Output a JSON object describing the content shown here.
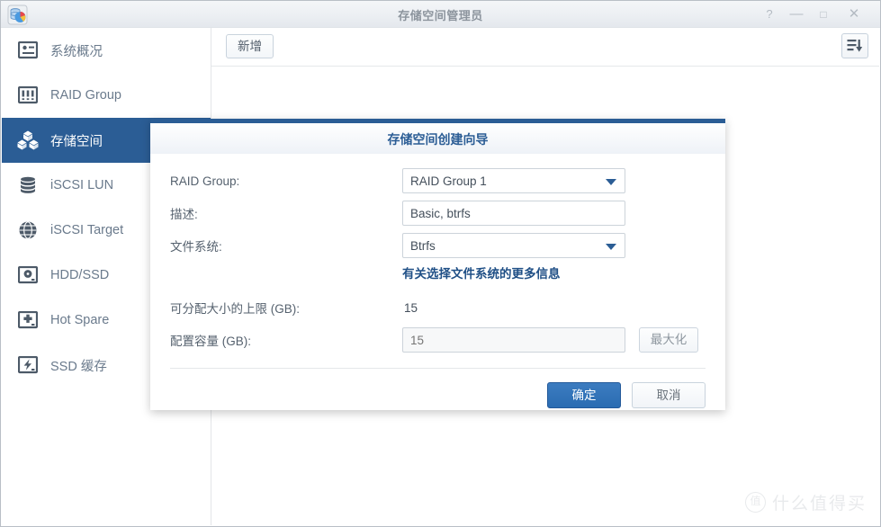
{
  "window": {
    "title": "存储空间管理员",
    "app_icon": "storage-manager-icon",
    "controls": {
      "help": "?",
      "minimize": "—",
      "maximize": "□",
      "close": "✕"
    }
  },
  "sidebar": {
    "items": [
      {
        "label": "系统概况",
        "icon": "system-overview-icon",
        "selected": false
      },
      {
        "label": "RAID Group",
        "icon": "raid-group-icon",
        "selected": false
      },
      {
        "label": "存储空间",
        "icon": "storage-volume-icon",
        "selected": true
      },
      {
        "label": "iSCSI LUN",
        "icon": "database-icon",
        "selected": false
      },
      {
        "label": "iSCSI Target",
        "icon": "globe-icon",
        "selected": false
      },
      {
        "label": "HDD/SSD",
        "icon": "disk-icon",
        "selected": false
      },
      {
        "label": "Hot Spare",
        "icon": "hot-spare-icon",
        "selected": false
      },
      {
        "label": "SSD 缓存",
        "icon": "ssd-cache-icon",
        "selected": false
      }
    ]
  },
  "toolbar": {
    "add_label": "新增",
    "sort_icon": "sort-descending-icon"
  },
  "dialog": {
    "title": "存储空间创建向导",
    "fields": {
      "raid_group": {
        "label": "RAID Group:",
        "value": "RAID Group 1",
        "type": "select"
      },
      "description": {
        "label": "描述:",
        "value": "Basic, btrfs",
        "type": "text"
      },
      "file_system": {
        "label": "文件系统:",
        "value": "Btrfs",
        "type": "select"
      },
      "max_size": {
        "label": "可分配大小的上限 (GB):",
        "value": "15",
        "type": "static"
      },
      "allocate_size": {
        "label": "配置容量 (GB):",
        "placeholder": "15",
        "value": "",
        "type": "text-disabled"
      }
    },
    "file_system_link": "有关选择文件系统的更多信息",
    "maximize_label": "最大化",
    "buttons": {
      "confirm": "确定",
      "cancel": "取消"
    }
  },
  "watermark": {
    "badge": "值",
    "text": "什么值得买"
  },
  "colors": {
    "accent_blue": "#2b5d95",
    "primary_button": "#2a6cb2",
    "sidebar_text": "#6a7a8c",
    "link": "#1f4f86"
  }
}
